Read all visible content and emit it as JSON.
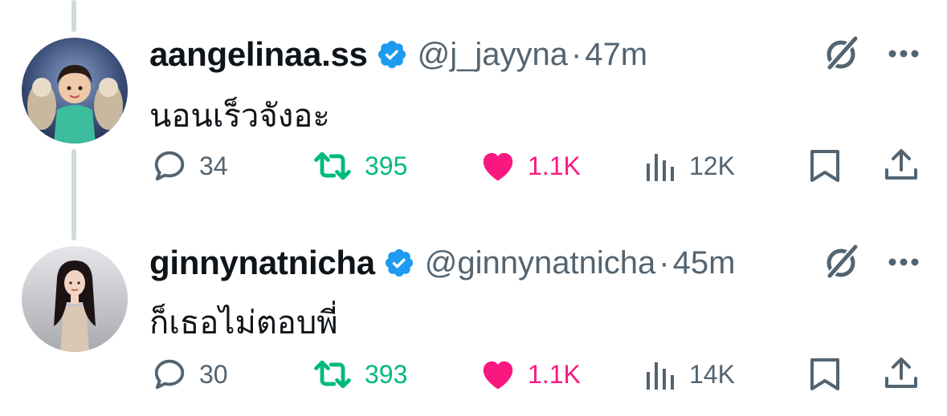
{
  "colors": {
    "retweet": "#00ba7c",
    "like": "#f91880",
    "muted": "#536471",
    "verified": "#1d9bf0"
  },
  "tweets": [
    {
      "display_name": "aangelinaa.ss",
      "handle": "@j_jayyna",
      "separator": "·",
      "time": "47m",
      "text": "นอนเร็วจังอะ",
      "stats": {
        "replies": "34",
        "retweets": "395",
        "likes": "1.1K",
        "views": "12K"
      }
    },
    {
      "display_name": "ginnynatnicha",
      "handle": "@ginnynatnicha",
      "separator": "·",
      "time": "45m",
      "text": "ก็เธอไม่ตอบพี่",
      "stats": {
        "replies": "30",
        "retweets": "393",
        "likes": "1.1K",
        "views": "14K"
      }
    }
  ],
  "icons": [
    "verified-badge-icon",
    "grok-icon",
    "more-icon",
    "reply-icon",
    "retweet-icon",
    "like-icon",
    "views-icon",
    "bookmark-icon",
    "share-icon"
  ]
}
